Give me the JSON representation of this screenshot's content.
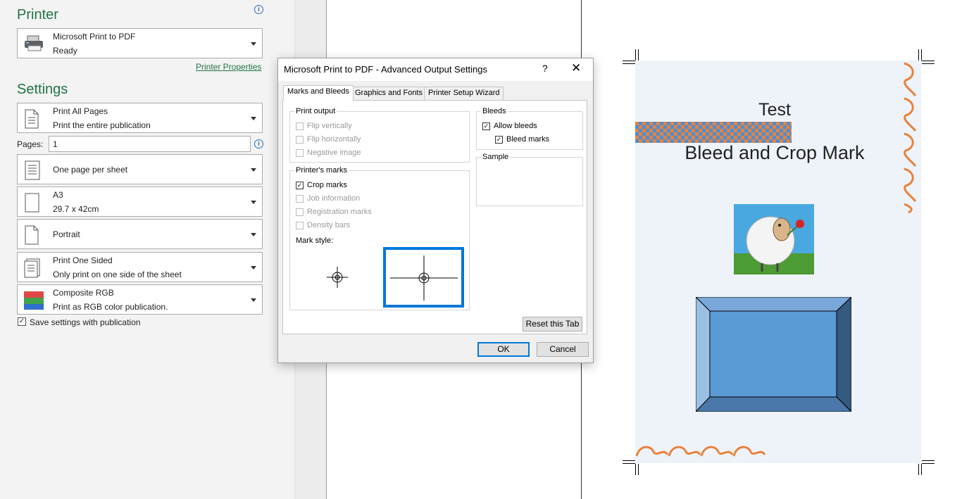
{
  "left_panel": {
    "printer_title": "Printer",
    "printer": {
      "name": "Microsoft Print to PDF",
      "status": "Ready"
    },
    "printer_properties_link": "Printer Properties",
    "settings_title": "Settings",
    "print_range": {
      "title": "Print All Pages",
      "desc": "Print the entire publication"
    },
    "pages_label": "Pages:",
    "pages_value": "1",
    "layout": {
      "title": "One page per sheet"
    },
    "paper": {
      "title": "A3",
      "desc": "29.7 x 42cm"
    },
    "orientation": {
      "title": "Portrait"
    },
    "sides": {
      "title": "Print One Sided",
      "desc": "Only print on one side of the sheet"
    },
    "color": {
      "title": "Composite RGB",
      "desc": "Print as RGB color publication."
    },
    "save_settings_label": "Save settings with publication",
    "save_settings_checked": true
  },
  "dialog": {
    "title": "Microsoft Print to PDF - Advanced Output Settings",
    "help_label": "?",
    "close_label": "✕",
    "tabs": [
      {
        "label": "Marks and Bleeds",
        "active": true
      },
      {
        "label": "Graphics and Fonts",
        "active": false
      },
      {
        "label": "Printer Setup Wizard",
        "active": false
      }
    ],
    "print_output": {
      "label": "Print output",
      "options": [
        {
          "label": "Flip vertically",
          "checked": false,
          "enabled": false
        },
        {
          "label": "Flip horizontally",
          "checked": false,
          "enabled": false
        },
        {
          "label": "Negative image",
          "checked": false,
          "enabled": false
        }
      ]
    },
    "printers_marks": {
      "label": "Printer's marks",
      "options": [
        {
          "label": "Crop marks",
          "checked": true,
          "enabled": true
        },
        {
          "label": "Job information",
          "checked": false,
          "enabled": false
        },
        {
          "label": "Registration marks",
          "checked": false,
          "enabled": false
        },
        {
          "label": "Density bars",
          "checked": false,
          "enabled": false
        }
      ],
      "mark_style_label": "Mark style:"
    },
    "bleeds": {
      "label": "Bleeds",
      "allow_bleeds": "Allow bleeds",
      "allow_bleeds_checked": true,
      "bleed_marks": "Bleed marks",
      "bleed_marks_checked": true
    },
    "sample_label": "Sample",
    "reset_button": "Reset this Tab",
    "ok_button": "OK",
    "cancel_button": "Cancel"
  },
  "preview": {
    "title": "Test",
    "subtitle": "Bleed and Crop Mark"
  },
  "colors": {
    "accent_green": "#217346",
    "dialog_blue": "#0078d7",
    "checker_orange": "#e8823c",
    "checker_blue": "#4a8fd6"
  }
}
